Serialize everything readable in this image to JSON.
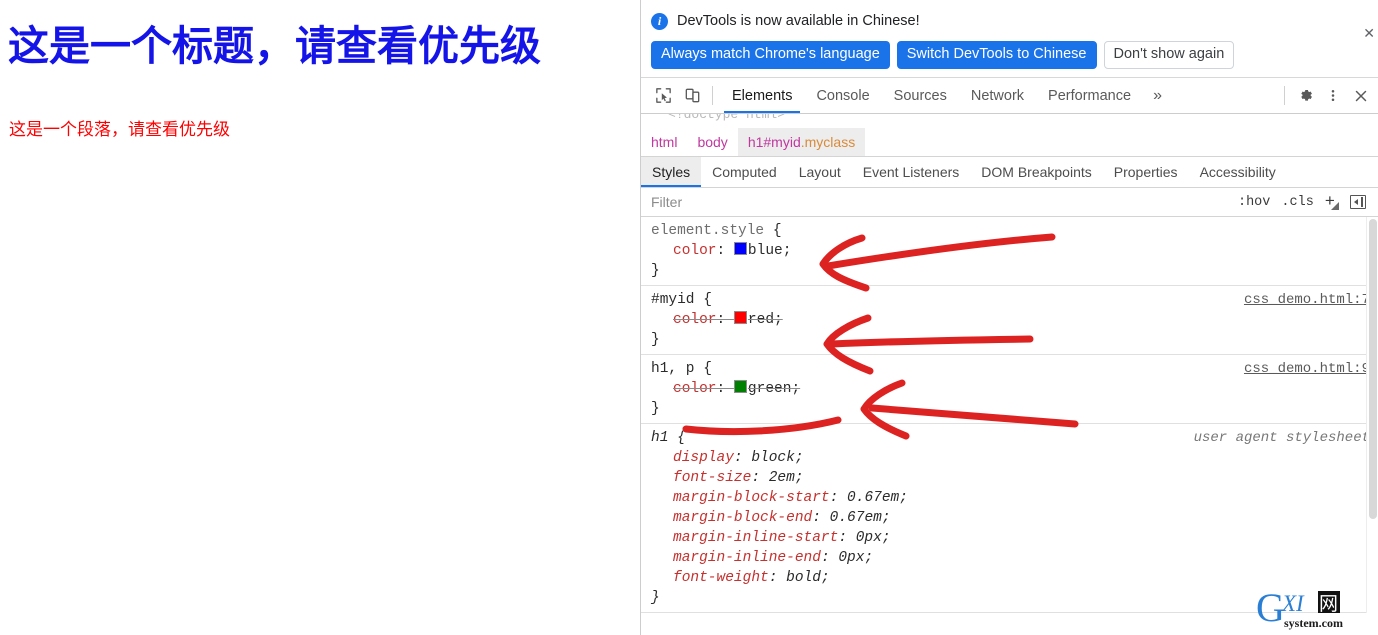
{
  "page": {
    "heading": "这是一个标题，请查看优先级",
    "heading_color": "#1414e8",
    "paragraph": "这是一个段落，请查看优先级",
    "paragraph_color": "#ff0000"
  },
  "notification": {
    "icon": "info-icon",
    "message": "DevTools is now available in Chinese!",
    "buttons": [
      {
        "label": "Always match Chrome's language",
        "style": "primary"
      },
      {
        "label": "Switch DevTools to Chinese",
        "style": "primary"
      },
      {
        "label": "Don't show again",
        "style": "secondary"
      }
    ],
    "close_label": "✕",
    "accent_color": "#1a73e8"
  },
  "toolbar": {
    "inspect_icon": "inspect-element-icon",
    "device_icon": "device-toolbar-icon",
    "tabs": [
      {
        "label": "Elements",
        "active": true
      },
      {
        "label": "Console",
        "active": false
      },
      {
        "label": "Sources",
        "active": false
      },
      {
        "label": "Network",
        "active": false
      },
      {
        "label": "Performance",
        "active": false
      }
    ],
    "more_tabs": "»",
    "settings_icon": "gear-icon",
    "menu_icon": "kebab-menu-icon",
    "close_icon": "close-icon"
  },
  "dom_sliver": "<!doctype html>",
  "breadcrumb": [
    {
      "tag": "html",
      "id": "",
      "cls": "",
      "selected": false
    },
    {
      "tag": "body",
      "id": "",
      "cls": "",
      "selected": false
    },
    {
      "tag": "h1",
      "id": "#myid",
      "cls": ".myclass",
      "selected": true
    }
  ],
  "sidebar_tabs": [
    {
      "label": "Styles",
      "active": true
    },
    {
      "label": "Computed",
      "active": false
    },
    {
      "label": "Layout",
      "active": false
    },
    {
      "label": "Event Listeners",
      "active": false
    },
    {
      "label": "DOM Breakpoints",
      "active": false
    },
    {
      "label": "Properties",
      "active": false
    },
    {
      "label": "Accessibility",
      "active": false
    }
  ],
  "filter": {
    "placeholder": "Filter",
    "value": "",
    "hov_label": ":hov",
    "cls_label": ".cls",
    "new_rule_label": "+",
    "sidebar_toggle": "toggle-sidebar-icon"
  },
  "style_rules": [
    {
      "selector": "element.style",
      "selector_muted": true,
      "origin": "",
      "origin_link": false,
      "ua": false,
      "declarations": [
        {
          "prop": "color",
          "value": "blue",
          "swatch": "#0000ff",
          "overridden": false
        }
      ]
    },
    {
      "selector": "#myid",
      "selector_muted": false,
      "origin": "css_demo.html:7",
      "origin_link": true,
      "ua": false,
      "declarations": [
        {
          "prop": "color",
          "value": "red",
          "swatch": "#ff0000",
          "overridden": true
        }
      ]
    },
    {
      "selector": "h1, p",
      "selector_muted": false,
      "origin": "css_demo.html:9",
      "origin_link": true,
      "ua": false,
      "declarations": [
        {
          "prop": "color",
          "value": "green",
          "swatch": "#008000",
          "overridden": true
        }
      ]
    },
    {
      "selector": "h1",
      "selector_muted": false,
      "origin": "user agent stylesheet",
      "origin_link": false,
      "ua": true,
      "declarations": [
        {
          "prop": "display",
          "value": "block",
          "swatch": "",
          "overridden": false
        },
        {
          "prop": "font-size",
          "value": "2em",
          "swatch": "",
          "overridden": false
        },
        {
          "prop": "margin-block-start",
          "value": "0.67em",
          "swatch": "",
          "overridden": false
        },
        {
          "prop": "margin-block-end",
          "value": "0.67em",
          "swatch": "",
          "overridden": false
        },
        {
          "prop": "margin-inline-start",
          "value": "0px",
          "swatch": "",
          "overridden": false
        },
        {
          "prop": "margin-inline-end",
          "value": "0px",
          "swatch": "",
          "overridden": false
        },
        {
          "prop": "font-weight",
          "value": "bold",
          "swatch": "",
          "overridden": false
        }
      ]
    }
  ],
  "annotations": {
    "color": "#dd2222",
    "arrow_count": 3
  },
  "watermark": {
    "primary": "G",
    "middle": "XI",
    "cjk": "网",
    "subtitle": "system.com",
    "color": "#2a7fd4"
  }
}
